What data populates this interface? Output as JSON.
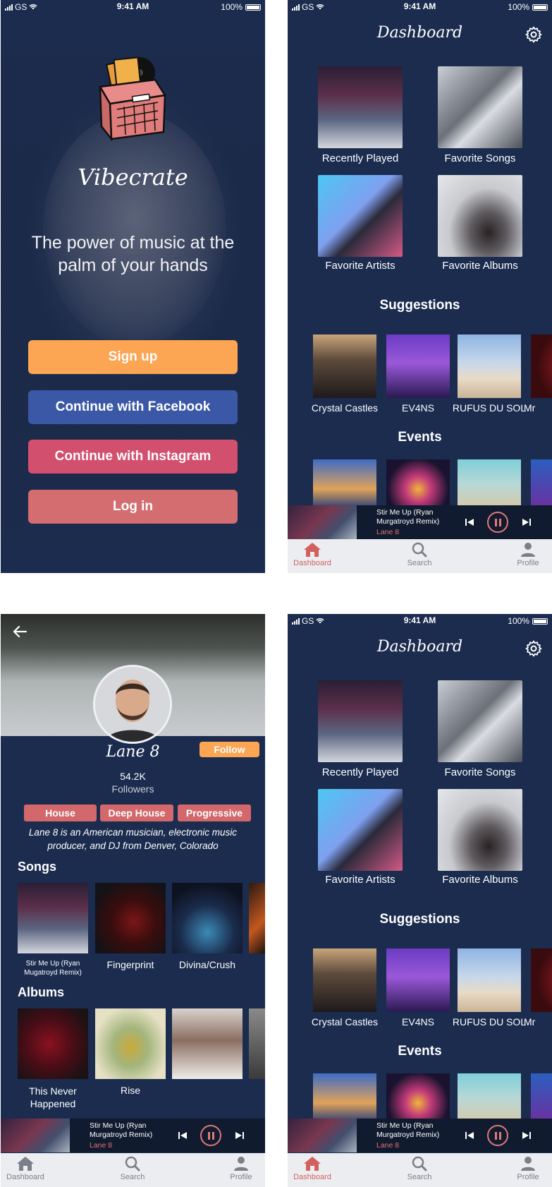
{
  "status": {
    "carrier": "GS",
    "time": "9:41 AM",
    "battery": "100%"
  },
  "welcome": {
    "brand": "Vibecrate",
    "tagline": "The power of music at the palm of your hands",
    "signup_label": "Sign up",
    "facebook_label": "Continue with Facebook",
    "instagram_label": "Continue with Instagram",
    "login_label": "Log in"
  },
  "dashboard": {
    "title": "Dashboard",
    "tiles": [
      "Recently Played",
      "Favorite Songs",
      "Favorite Artists",
      "Favorite Albums"
    ],
    "suggestions_heading": "Suggestions",
    "suggestions": [
      "Crystal Castles",
      "EV4NS",
      "RUFUS DU SOL",
      "Mr"
    ],
    "events_heading": "Events"
  },
  "player": {
    "title": "Stir Me Up (Ryan Murgatroyd Remix)",
    "artist": "Lane 8"
  },
  "tabs": {
    "dashboard": "Dashboard",
    "search": "Search",
    "profile": "Profile"
  },
  "artist": {
    "name": "Lane 8",
    "follow_label": "Follow",
    "followers_count": "54.2K",
    "followers_label": "Followers",
    "tags": [
      "House",
      "Deep House",
      "Progressive"
    ],
    "bio": "Lane 8 is an American musician, electronic music producer, and DJ from Denver, Colorado",
    "songs_heading": "Songs",
    "songs": [
      "Stir Me Up (Ryan Mugatroyd Remix)",
      "Fingerprint",
      "Divina/Crush"
    ],
    "albums_heading": "Albums",
    "albums": [
      "This Never Happened",
      "Rise"
    ]
  },
  "colors": {
    "navy": "#1b2c4f",
    "orange": "#fca553",
    "facebook": "#3b58a6",
    "instagram": "#d34f6e",
    "login": "#d46d6f",
    "accent_red": "#d2615e"
  }
}
